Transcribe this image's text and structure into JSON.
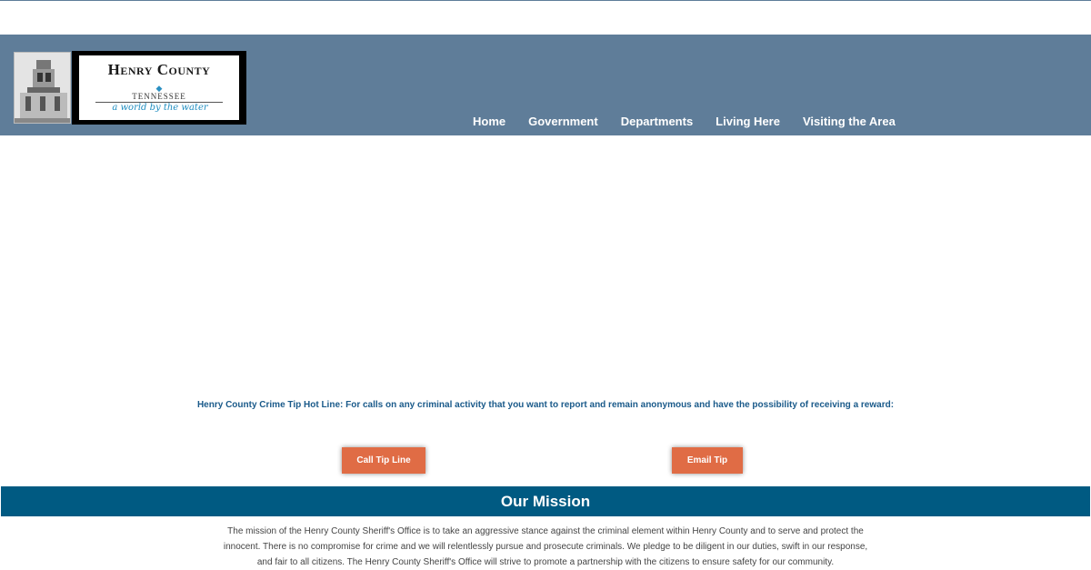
{
  "logo": {
    "title": "Henry County",
    "subtitle": "TENNESSEE",
    "tagline": "a world by the water"
  },
  "nav": {
    "items": [
      "Home",
      "Government",
      "Departments",
      "Living Here",
      "Visiting the Area"
    ]
  },
  "tip_line": {
    "text": "Henry County Crime Tip Hot Line: For calls on any criminal activity that you want to report and remain anonymous and have the possibility of receiving a reward:",
    "call_label": "Call Tip Line",
    "email_label": "Email Tip"
  },
  "mission": {
    "title": "Our Mission",
    "text": "The mission of the Henry County Sheriff's Office is to take an aggressive stance against the criminal element within Henry County and to serve and protect the innocent. There is no compromise for crime and we will relentlessly pursue and prosecute criminals. We pledge to be diligent in our duties, swift in our response, and fair to all citizens. The Henry County Sheriff's Office will strive to promote a partnership with the citizens to ensure safety for our community."
  },
  "colors": {
    "header": "#5f7d99",
    "mission_bar": "#005a82",
    "button": "#e06c45",
    "tip_text": "#1a5a8a"
  }
}
